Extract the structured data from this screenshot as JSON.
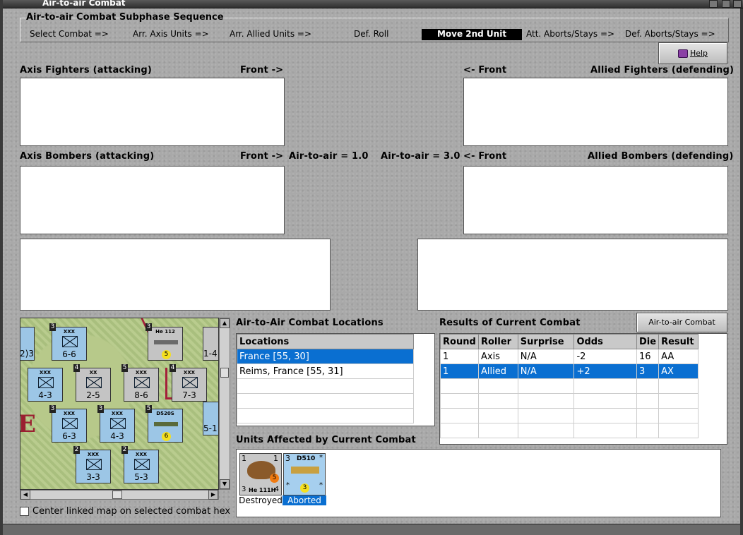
{
  "window": {
    "title": "Air-to-air Combat"
  },
  "sequence": {
    "title": "Air-to-air Combat Subphase Sequence",
    "steps": [
      "Select Combat =>",
      "Arr. Axis Units =>",
      "Arr. Allied Units =>",
      "Def. Roll",
      "Move 2nd Unit",
      "Att. Aborts/Stays =>",
      "Def. Aborts/Stays =>"
    ],
    "active_step": "Move 2nd Unit"
  },
  "help_button": {
    "label": "Help",
    "icon": "help-book-icon"
  },
  "fighters": {
    "axis_label": "Axis Fighters (attacking)",
    "axis_front": "Front ->",
    "allied_front": "<- Front",
    "allied_label": "Allied Fighters (defending)"
  },
  "bombers": {
    "axis_label": "Axis Bombers (attacking)",
    "axis_front": "Front ->",
    "axis_ratio": "Air-to-air = 1.0",
    "allied_ratio": "Air-to-air = 3.0",
    "allied_front": "<- Front",
    "allied_label": "Allied Bombers (defending)"
  },
  "locations": {
    "title": "Air-to-Air Combat Locations",
    "header": "Locations",
    "rows": [
      "France [55, 30]",
      "Reims, France [55, 31]",
      "",
      "",
      ""
    ],
    "selected_index": 0
  },
  "results": {
    "title": "Results of Current Combat",
    "chart_button": "Air-to-air Combat Chart",
    "columns": [
      "Round",
      "Roller",
      "Surprise",
      "Odds",
      "Die",
      "Result"
    ],
    "rows": [
      [
        "1",
        "Axis",
        "N/A",
        "-2",
        "16",
        "AA"
      ],
      [
        "1",
        "Allied",
        "N/A",
        "+2",
        "3",
        "AX"
      ],
      [
        "",
        "",
        "",
        "",
        "",
        ""
      ],
      [
        "",
        "",
        "",
        "",
        "",
        ""
      ],
      [
        "",
        "",
        "",
        "",
        "",
        ""
      ],
      [
        "",
        "",
        "",
        "",
        "",
        ""
      ]
    ],
    "selected_index": 1
  },
  "affected": {
    "title": "Units Affected by Current Combat",
    "units": [
      {
        "top_left": "1",
        "top_right": "1",
        "bottom_left": "3",
        "name": "He 111H",
        "bottom_right": "4",
        "die": "5",
        "status": "Destroyed"
      },
      {
        "top_left": "3",
        "name": "D510",
        "top_right": "*",
        "bottom_left": "*",
        "die": "3",
        "bottom_right": "*",
        "status": "Aborted"
      }
    ]
  },
  "map": {
    "counters": [
      {
        "type": "XXX",
        "str": "6-6",
        "num": "3"
      },
      {
        "type": "He 112",
        "str": "5",
        "num": "3"
      },
      {
        "type": "XXX",
        "str": "4-3",
        "num": ""
      },
      {
        "type": "XX",
        "str": "2-5",
        "num": "4"
      },
      {
        "type": "XXX",
        "str": "8-6",
        "num": "5"
      },
      {
        "type": "XXX",
        "str": "7-3",
        "num": "4"
      },
      {
        "type": "XXX",
        "str": "6-3",
        "num": "3"
      },
      {
        "type": "XXX",
        "str": "4-3",
        "num": "3"
      },
      {
        "type": "D520S",
        "str": "6",
        "num": "5"
      },
      {
        "type": "XXX",
        "str": "3-3",
        "num": "2"
      },
      {
        "type": "XXX",
        "str": "5-3",
        "num": "2"
      }
    ],
    "edge_strs": [
      "2)3",
      "1-4",
      "5-1"
    ],
    "edge_letter": "E"
  },
  "center_checkbox": {
    "label": "Center linked map on selected combat hex",
    "checked": false
  }
}
